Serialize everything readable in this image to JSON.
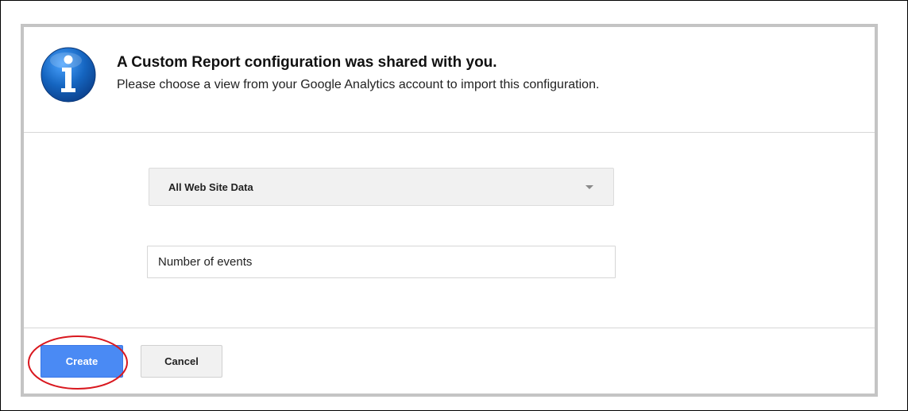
{
  "dialog": {
    "title": "A Custom Report configuration was shared with you.",
    "subtitle": "Please choose a view from your Google Analytics account to import this configuration.",
    "icon": "info-icon"
  },
  "form": {
    "view_select": {
      "selected": "All Web Site Data",
      "icon": "caret-down-icon"
    },
    "report_name": {
      "value": "Number of events"
    }
  },
  "actions": {
    "create_label": "Create",
    "cancel_label": "Cancel"
  },
  "annotation": {
    "highlight_target": "create-button",
    "color": "#d9181f"
  },
  "colors": {
    "primary_button": "#4a8af4",
    "dialog_border": "#c4c4c4"
  }
}
